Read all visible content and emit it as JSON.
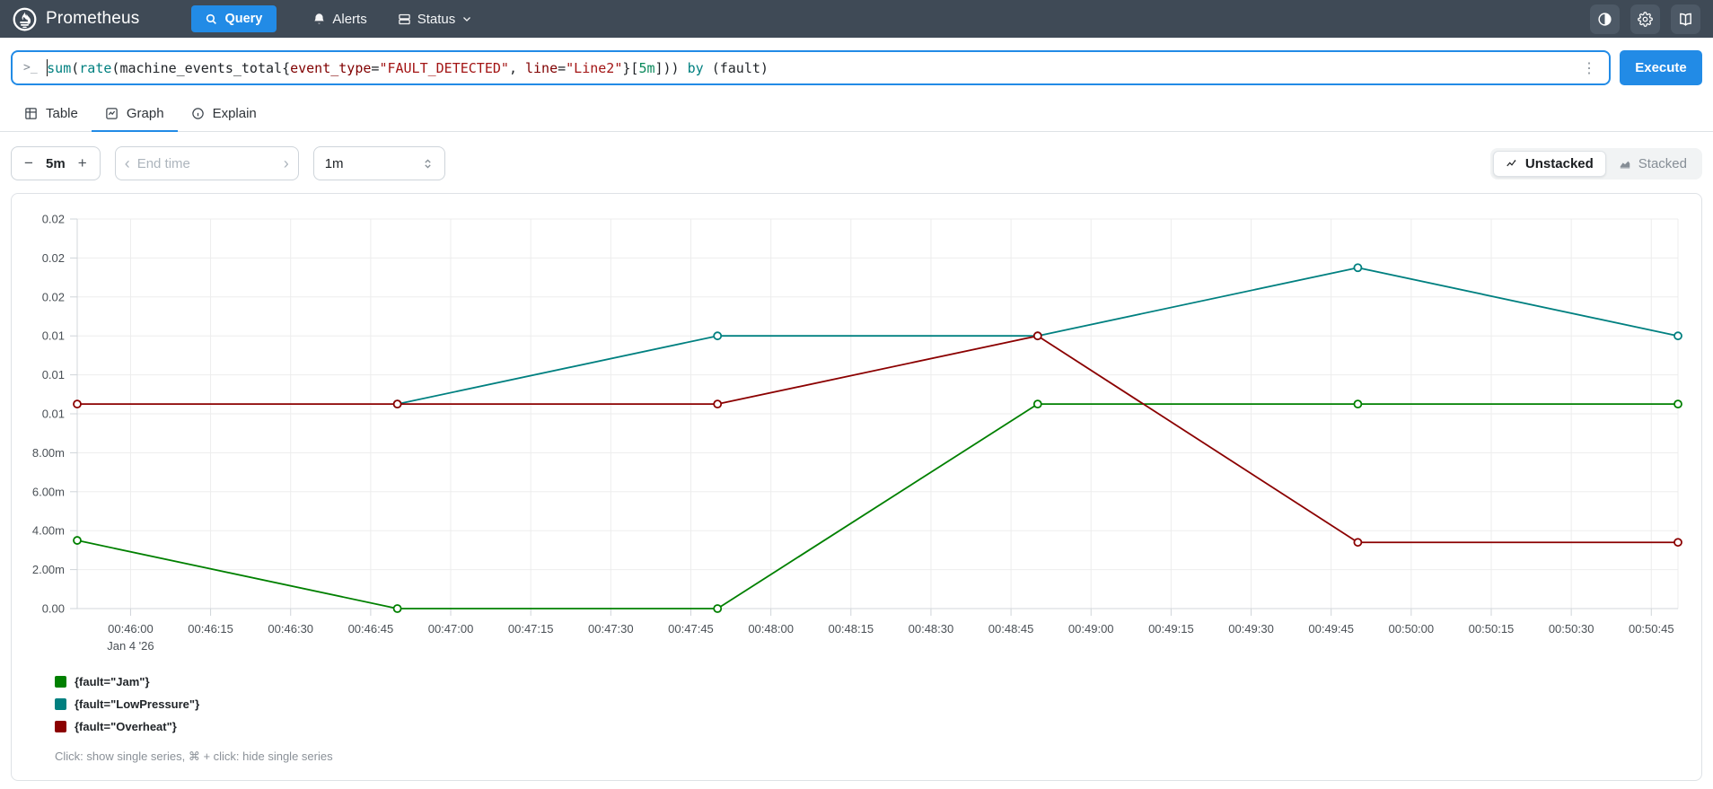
{
  "nav": {
    "brand": "Prometheus",
    "query_label": "Query",
    "alerts_label": "Alerts",
    "status_label": "Status"
  },
  "icons": {
    "prompt": ">_",
    "kebab": "⋮",
    "minus": "−",
    "plus": "+",
    "chevron_left": "‹",
    "chevron_right": "›"
  },
  "query": {
    "tokens": [
      {
        "text": "sum",
        "type": "fn"
      },
      {
        "text": "(",
        "type": "pl"
      },
      {
        "text": "rate",
        "type": "fn"
      },
      {
        "text": "(",
        "type": "pl"
      },
      {
        "text": "machine_events_total",
        "type": "mt"
      },
      {
        "text": "{",
        "type": "pl"
      },
      {
        "text": "event_type",
        "type": "lb"
      },
      {
        "text": "=",
        "type": "pl"
      },
      {
        "text": "\"FAULT_DETECTED\"",
        "type": "st"
      },
      {
        "text": ", ",
        "type": "pl"
      },
      {
        "text": "line",
        "type": "lb"
      },
      {
        "text": "=",
        "type": "pl"
      },
      {
        "text": "\"Line2\"",
        "type": "st"
      },
      {
        "text": "}[",
        "type": "pl"
      },
      {
        "text": "5m",
        "type": "du"
      },
      {
        "text": "])) ",
        "type": "pl"
      },
      {
        "text": "by",
        "type": "kw"
      },
      {
        "text": " (fault)",
        "type": "pl"
      }
    ],
    "execute_label": "Execute"
  },
  "tabs": {
    "table": "Table",
    "graph": "Graph",
    "explain": "Explain"
  },
  "controls": {
    "range": "5m",
    "end_time_placeholder": "End time",
    "resolution": "1m",
    "unstacked_label": "Unstacked",
    "stacked_label": "Stacked"
  },
  "chart_data": {
    "type": "line",
    "x_labels": [
      "00:45:50",
      "00:46:50",
      "00:47:50",
      "00:48:50",
      "00:49:50",
      "00:50:50"
    ],
    "x_offsets_s": [
      0,
      60,
      120,
      180,
      240,
      300
    ],
    "x_range_s": 300,
    "x_tick_start_offset_s": 10,
    "x_tick_step_s": 15,
    "x_tick_labels": [
      "00:46:00",
      "00:46:15",
      "00:46:30",
      "00:46:45",
      "00:47:00",
      "00:47:15",
      "00:47:30",
      "00:47:45",
      "00:48:00",
      "00:48:15",
      "00:48:30",
      "00:48:45",
      "00:49:00",
      "00:49:15",
      "00:49:30",
      "00:49:45",
      "00:50:00",
      "00:50:15",
      "00:50:30",
      "00:50:45"
    ],
    "x_first_tick_sub_label": "Jan 4 '26",
    "ylim": [
      0,
      0.02
    ],
    "y_tick_labels": [
      "0.00",
      "2.00m",
      "4.00m",
      "6.00m",
      "8.00m",
      "0.01",
      "0.01",
      "0.01",
      "0.02",
      "0.02",
      "0.02"
    ],
    "grid": true,
    "legend_position": "bottom-left",
    "series": [
      {
        "name": "{fault=\"Jam\"}",
        "color": "#008000",
        "values": [
          0.0035,
          0,
          0,
          0.0105,
          0.0105,
          0.0105
        ]
      },
      {
        "name": "{fault=\"LowPressure\"}",
        "color": "#008080",
        "values": [
          null,
          0.0105,
          0.014,
          0.014,
          0.0175,
          0.014
        ]
      },
      {
        "name": "{fault=\"Overheat\"}",
        "color": "#8b0000",
        "values": [
          0.0105,
          0.0105,
          0.0105,
          0.014,
          0.0034,
          0.0034
        ]
      }
    ]
  },
  "footer": {
    "hint": "Click: show single series, ⌘ + click: hide single series"
  }
}
